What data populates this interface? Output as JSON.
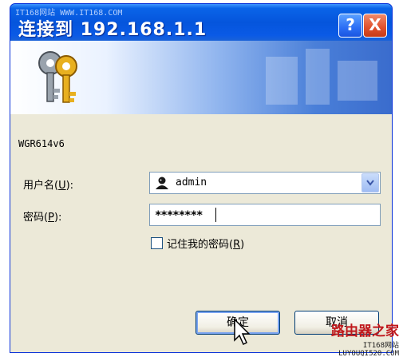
{
  "watermark_top": "IT168网站 WWW.IT168.COM",
  "title": "连接到 192.168.1.1",
  "buttons": {
    "help": "?",
    "close": "X",
    "ok": "确定",
    "cancel": "取消"
  },
  "realm": "WGR614v6",
  "username": {
    "label": "用户名",
    "mnemonic": "U",
    "value": "admin"
  },
  "password": {
    "label": "密码",
    "mnemonic": "P",
    "value": "********"
  },
  "remember": {
    "label": "记住我的密码",
    "mnemonic": "R",
    "checked": false
  },
  "watermark_bottom": {
    "logo": "路由器之家",
    "url": "IT168网站 LUYOUQI520.COM"
  },
  "colors": {
    "title_bar": "#0555dc",
    "close_button": "#e0502c",
    "dialog_bg": "#ece9d8",
    "watermark_red": "#c0181c"
  }
}
